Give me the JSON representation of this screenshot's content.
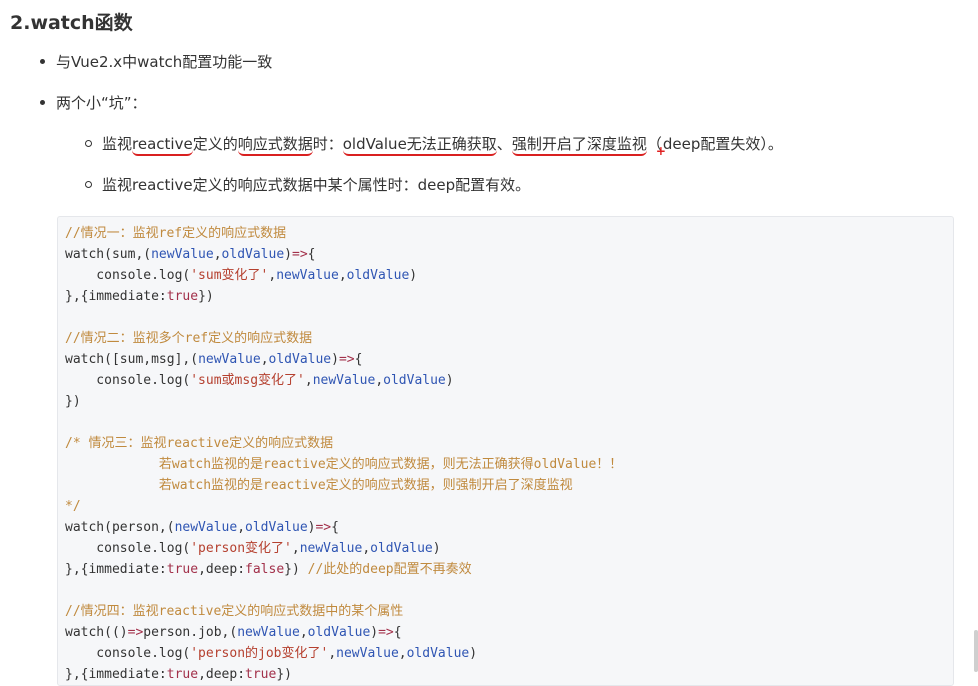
{
  "heading": "2.watch函数",
  "bullets": [
    {
      "text": "与Vue2.x中watch配置功能一致"
    },
    {
      "text": "两个小“坑”："
    }
  ],
  "sub_bullets": [
    {
      "p1": "监视",
      "p2": "reactive",
      "p3": "定义的",
      "p4": "响应式数据",
      "p5": "时：",
      "p6": "oldValue无法正确获取",
      "p7": "、",
      "p8": "强制开启了深度监视",
      "p9": "（",
      "p10": "+",
      "p11": "deep配置失效）。"
    },
    {
      "text": "监视reactive定义的响应式数据中某个属性时：deep配置有效。"
    }
  ],
  "code": {
    "l1": "//情况一：监视ref定义的响应式数据",
    "l2_a": "watch(sum,(",
    "l2_b": "newValue",
    "l2_c": ",",
    "l2_d": "oldValue",
    "l2_e": ")",
    "l2_f": "=>",
    "l2_g": "{",
    "l3_a": "    console.log(",
    "l3_b": "'sum变化了'",
    "l3_c": ",",
    "l3_d": "newValue",
    "l3_e": ",",
    "l3_f": "oldValue",
    "l3_g": ")",
    "l4_a": "},{immediate:",
    "l4_b": "true",
    "l4_c": "})",
    "l6": "//情况二：监视多个ref定义的响应式数据",
    "l7_a": "watch([sum,msg],(",
    "l7_b": "newValue",
    "l7_c": ",",
    "l7_d": "oldValue",
    "l7_e": ")",
    "l7_f": "=>",
    "l7_g": "{",
    "l8_a": "    console.log(",
    "l8_b": "'sum或msg变化了'",
    "l8_c": ",",
    "l8_d": "newValue",
    "l8_e": ",",
    "l8_f": "oldValue",
    "l8_g": ")",
    "l9": "})",
    "l11": "/* 情况三：监视reactive定义的响应式数据",
    "l12": "            若watch监视的是reactive定义的响应式数据，则无法正确获得oldValue！！",
    "l13": "            若watch监视的是reactive定义的响应式数据，则强制开启了深度监视",
    "l14": "*/",
    "l15_a": "watch(person,(",
    "l15_b": "newValue",
    "l15_c": ",",
    "l15_d": "oldValue",
    "l15_e": ")",
    "l15_f": "=>",
    "l15_g": "{",
    "l16_a": "    console.log(",
    "l16_b": "'person变化了'",
    "l16_c": ",",
    "l16_d": "newValue",
    "l16_e": ",",
    "l16_f": "oldValue",
    "l16_g": ")",
    "l17_a": "},{immediate:",
    "l17_b": "true",
    "l17_c": ",deep:",
    "l17_d": "false",
    "l17_e": "}) ",
    "l17_f": "//此处的deep配置不再奏效",
    "l19": "//情况四：监视reactive定义的响应式数据中的某个属性",
    "l20_a": "watch(()",
    "l20_b": "=>",
    "l20_c": "person.job,(",
    "l20_d": "newValue",
    "l20_e": ",",
    "l20_f": "oldValue",
    "l20_g": ")",
    "l20_h": "=>",
    "l20_i": "{",
    "l21_a": "    console.log(",
    "l21_b": "'person的job变化了'",
    "l21_c": ",",
    "l21_d": "newValue",
    "l21_e": ",",
    "l21_f": "oldValue",
    "l21_g": ")",
    "l22_a": "},{immediate:",
    "l22_b": "true",
    "l22_c": ",deep:",
    "l22_d": "true",
    "l22_e": "})"
  },
  "colors": {
    "comment": "#c08a3e",
    "string": "#b5402f",
    "variable": "#2f55b3",
    "keyword": "#a2304a",
    "annotation_underline": "#d92020"
  }
}
